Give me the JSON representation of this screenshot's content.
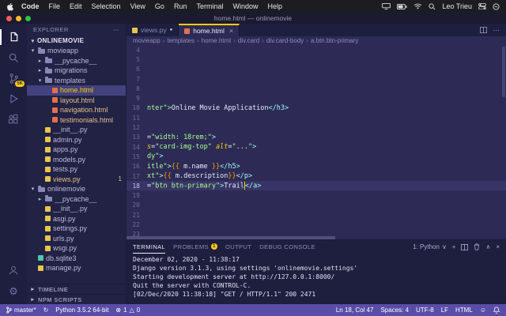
{
  "colors": {
    "accent": "#FAD000",
    "statusbar_bg": "#5A4DA8",
    "editor_bg": "#2D2B55",
    "sidebar_bg": "#222244",
    "panel_bg": "#1E1E3F",
    "syntax": {
      "string": "#A5FF90",
      "tag": "#9EFFFF",
      "attr": "#FAD000",
      "template": "#FF9D00",
      "text": "#E8E8FF"
    },
    "file_icons": {
      "py": "#E8C64E",
      "html": "#E5704C",
      "db": "#4EC9B0"
    }
  },
  "icons": {
    "chevron-open": "▾",
    "chevron-closed": "▸",
    "breadcrumb-separator": "›",
    "close": "×",
    "more": "⋯",
    "modified-dot": "●",
    "error": "⊗",
    "warning": "△",
    "sync": "↻",
    "gear": "⚙",
    "smiley": "☺",
    "plus": "+",
    "chevron-down": "∨",
    "chevron-up": "∧"
  },
  "menubar": {
    "items": [
      "Code",
      "File",
      "Edit",
      "Selection",
      "View",
      "Go",
      "Run",
      "Terminal",
      "Window",
      "Help"
    ],
    "username": "Leo Trieu"
  },
  "titlebar": {
    "title": "home.html — onlinemovie"
  },
  "activitybar": {
    "scm_badge": "5K"
  },
  "explorer": {
    "title": "EXPLORER",
    "section": "ONLINEMOVIE",
    "tree": [
      {
        "label": "movieapp",
        "depth": 0,
        "kind": "folder",
        "state": "open"
      },
      {
        "label": "__pycache__",
        "depth": 1,
        "kind": "folder",
        "state": "closed"
      },
      {
        "label": "migrations",
        "depth": 1,
        "kind": "folder",
        "state": "closed"
      },
      {
        "label": "templates",
        "depth": 1,
        "kind": "folder",
        "state": "open"
      },
      {
        "label": "home.html",
        "depth": 2,
        "kind": "html",
        "selected": true,
        "git": "modified"
      },
      {
        "label": "layout.html",
        "depth": 2,
        "kind": "html",
        "git": "modified"
      },
      {
        "label": "navigation.html",
        "depth": 2,
        "kind": "html",
        "git": "modified"
      },
      {
        "label": "testimonials.html",
        "depth": 2,
        "kind": "html",
        "git": "modified"
      },
      {
        "label": "__init__.py",
        "depth": 1,
        "kind": "py"
      },
      {
        "label": "admin.py",
        "depth": 1,
        "kind": "py"
      },
      {
        "label": "apps.py",
        "depth": 1,
        "kind": "py"
      },
      {
        "label": "models.py",
        "depth": 1,
        "kind": "py"
      },
      {
        "label": "tests.py",
        "depth": 1,
        "kind": "py"
      },
      {
        "label": "views.py",
        "depth": 1,
        "kind": "py",
        "git": "modified",
        "badge": "1"
      },
      {
        "label": "onlinemovie",
        "depth": 0,
        "kind": "folder",
        "state": "open"
      },
      {
        "label": "__pycache__",
        "depth": 1,
        "kind": "folder",
        "state": "closed"
      },
      {
        "label": "__init__.py",
        "depth": 1,
        "kind": "py"
      },
      {
        "label": "asgi.py",
        "depth": 1,
        "kind": "py"
      },
      {
        "label": "settings.py",
        "depth": 1,
        "kind": "py"
      },
      {
        "label": "urls.py",
        "depth": 1,
        "kind": "py"
      },
      {
        "label": "wsgi.py",
        "depth": 1,
        "kind": "py"
      },
      {
        "label": "db.sqlite3",
        "depth": 0,
        "kind": "db"
      },
      {
        "label": "manage.py",
        "depth": 0,
        "kind": "py"
      }
    ],
    "bottom_sections": [
      "TIMELINE",
      "NPM SCRIPTS"
    ]
  },
  "tabs": [
    {
      "label": "views.py",
      "icon": "py",
      "modified": true
    },
    {
      "label": "home.html",
      "icon": "html",
      "active": true
    }
  ],
  "breadcrumbs": [
    "movieapp",
    "templates",
    "home.html",
    "div.card",
    "div.card-body",
    "a.btn.btn-primary"
  ],
  "editor": {
    "lines": [
      {
        "num": "4"
      },
      {
        "num": "5"
      },
      {
        "num": "6"
      },
      {
        "num": "7"
      },
      {
        "num": "8"
      },
      {
        "num": "9"
      },
      {
        "num": "10",
        "segments": [
          {
            "t": "nter\">",
            "c": "string"
          },
          {
            "t": "Online Movie Application",
            "c": "text"
          },
          {
            "t": "</h3>",
            "c": "tag"
          }
        ]
      },
      {
        "num": "11"
      },
      {
        "num": "12"
      },
      {
        "num": "13",
        "segments": [
          {
            "t": "=",
            "c": "text"
          },
          {
            "t": "\"width: 18rem;\"",
            "c": "string"
          },
          {
            "t": ">",
            "c": "tag"
          }
        ]
      },
      {
        "num": "14",
        "segments": [
          {
            "t": "s",
            "c": "attr"
          },
          {
            "t": "=",
            "c": "text"
          },
          {
            "t": "\"card-img-top\"",
            "c": "string"
          },
          {
            "t": " ",
            "c": "text"
          },
          {
            "t": "alt",
            "c": "attr"
          },
          {
            "t": "=",
            "c": "text"
          },
          {
            "t": "\"...\"",
            "c": "string"
          },
          {
            "t": ">",
            "c": "tag"
          }
        ]
      },
      {
        "num": "15",
        "segments": [
          {
            "t": "dy\"",
            "c": "string"
          },
          {
            "t": ">",
            "c": "tag"
          }
        ]
      },
      {
        "num": "16",
        "segments": [
          {
            "t": "itle\"",
            "c": "string"
          },
          {
            "t": ">",
            "c": "tag"
          },
          {
            "t": "{{",
            "c": "template"
          },
          {
            "t": " m.name ",
            "c": "text"
          },
          {
            "t": "}}",
            "c": "template"
          },
          {
            "t": "</h5>",
            "c": "tag"
          }
        ]
      },
      {
        "num": "17",
        "segments": [
          {
            "t": "xt\"",
            "c": "string"
          },
          {
            "t": ">",
            "c": "tag"
          },
          {
            "t": "{{",
            "c": "template"
          },
          {
            "t": " m.description",
            "c": "text"
          },
          {
            "t": "}}",
            "c": "template"
          },
          {
            "t": "</p>",
            "c": "tag"
          }
        ]
      },
      {
        "num": "18",
        "current": true,
        "segments": [
          {
            "t": "=",
            "c": "text"
          },
          {
            "t": "\"btn btn-primary\"",
            "c": "string"
          },
          {
            "t": ">",
            "c": "tag"
          },
          {
            "t": "Trail",
            "c": "text",
            "cursor": true
          },
          {
            "t": "</a>",
            "c": "tag"
          }
        ]
      },
      {
        "num": "19"
      },
      {
        "num": "20"
      },
      {
        "num": "21"
      },
      {
        "num": "22"
      },
      {
        "num": "23"
      }
    ]
  },
  "panel": {
    "tabs": [
      {
        "label": "TERMINAL",
        "active": true
      },
      {
        "label": "PROBLEMS",
        "badge": "1"
      },
      {
        "label": "OUTPUT"
      },
      {
        "label": "DEBUG CONSOLE"
      }
    ],
    "shell": "1: Python",
    "lines": [
      "December 02, 2020 - 11:38:17",
      "Django version 3.1.3, using settings 'onlinemovie.settings'",
      "Starting development server at http://127.0.0.1:8000/",
      "Quit the server with CONTROL-C.",
      "[02/Dec/2020 11:38:18] \"GET / HTTP/1.1\" 200 2471"
    ]
  },
  "statusbar": {
    "branch": "master*",
    "interpreter": "Python 3.5.2 64-bit",
    "errors": "1",
    "warnings": "0",
    "cursor": "Ln 18, Col 47",
    "indent": "Spaces: 4",
    "encoding": "UTF-8",
    "eol": "LF",
    "language": "HTML"
  }
}
